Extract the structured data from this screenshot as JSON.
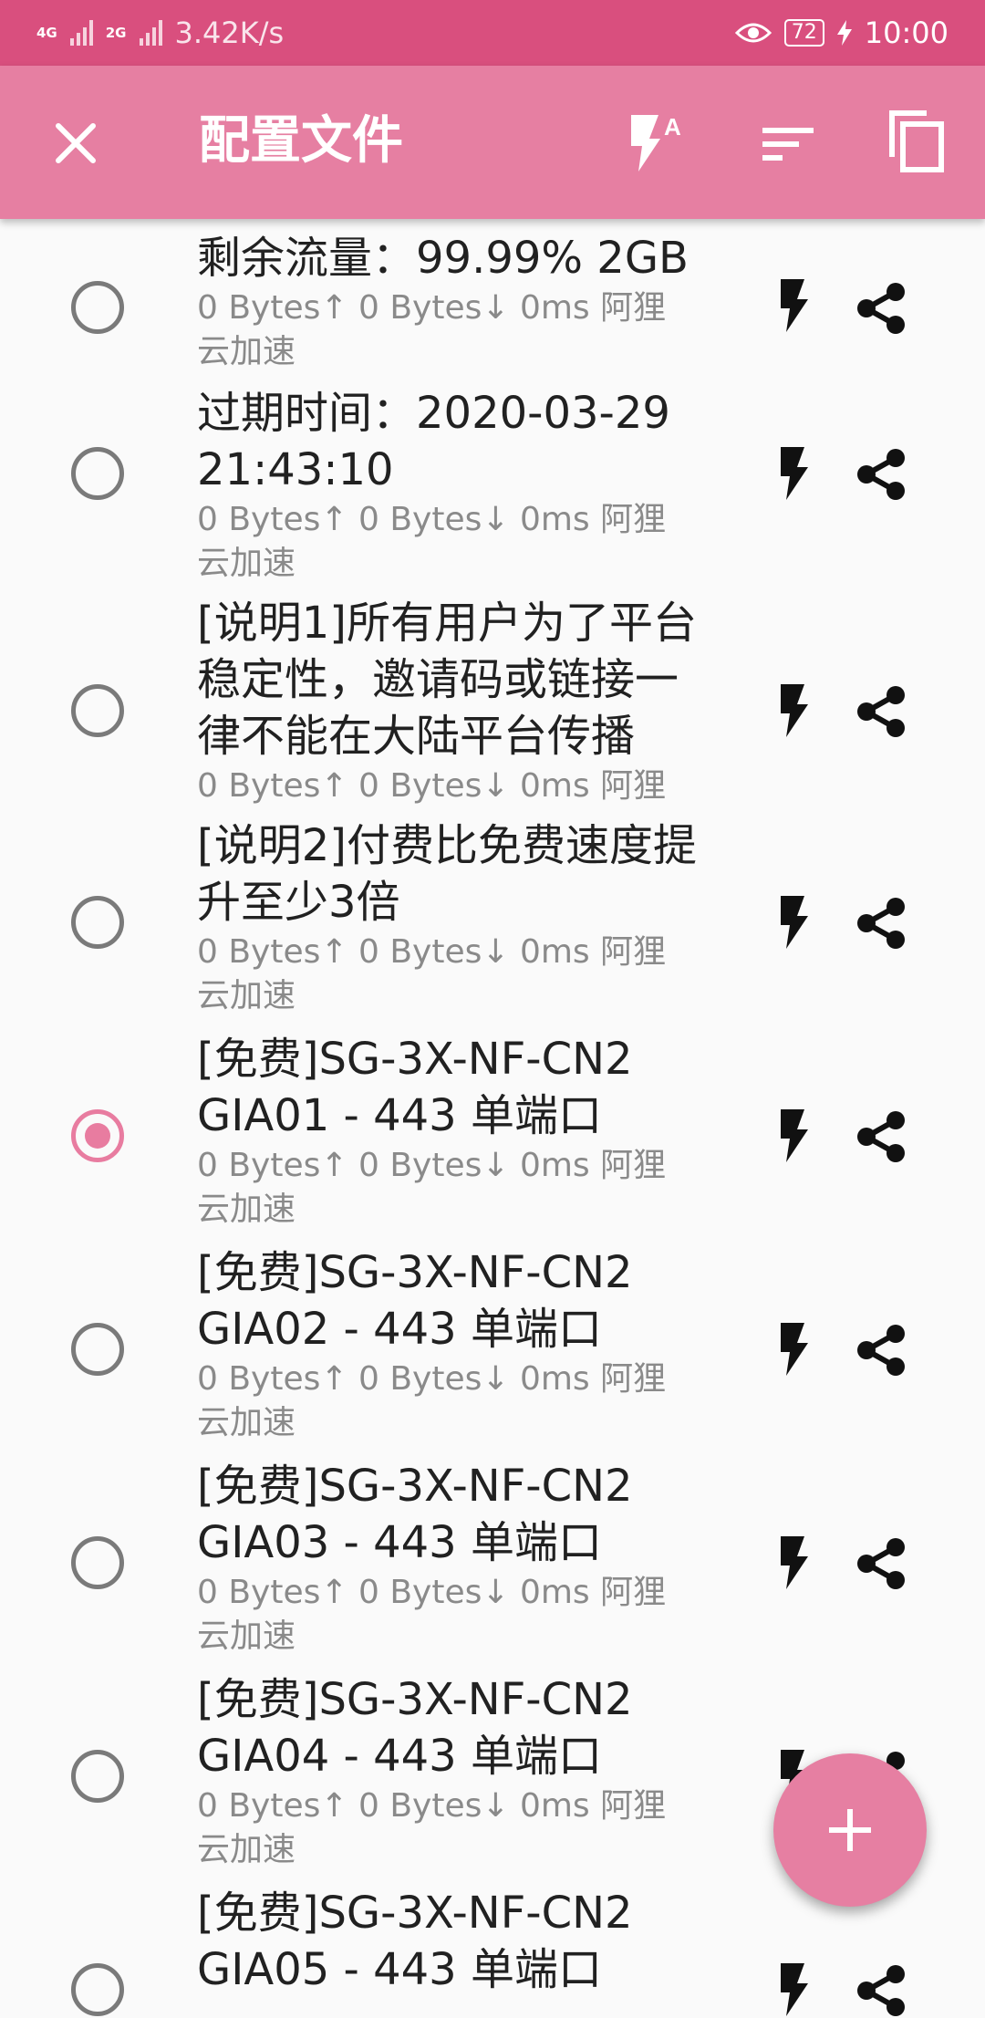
{
  "status_bar": {
    "network_1": "4G",
    "network_2": "2G",
    "speed": "3.42K/s",
    "battery": "72",
    "time": "10:00"
  },
  "app_bar": {
    "title": "配置文件",
    "icons": [
      "close-icon",
      "flash-auto-icon",
      "sort-icon",
      "copy-icon"
    ]
  },
  "accent_color": "#e67fa2",
  "status_color": "#d94f7e",
  "profiles": [
    {
      "name": "剩余流量：99.99% 2GB",
      "stats": "0 Bytes↑  0 Bytes↓  0ms  阿狸\n云加速",
      "selected": false
    },
    {
      "name": "过期时间：2020-03-29\n21:43:10",
      "stats": "0 Bytes↑  0 Bytes↓  0ms  阿狸\n云加速",
      "selected": false
    },
    {
      "name": "[说明1]所有用户为了平台\n稳定性，邀请码或链接一\n律不能在大陆平台传播",
      "stats": "0 Bytes↑  0 Bytes↓  0ms  阿狸",
      "selected": false
    },
    {
      "name": "[说明2]付费比免费速度提\n升至少3倍",
      "stats": "0 Bytes↑  0 Bytes↓  0ms  阿狸\n云加速",
      "selected": false
    },
    {
      "name": "[免费]SG-3X-NF-CN2\nGIA01 - 443 单端口",
      "stats": "0 Bytes↑  0 Bytes↓  0ms  阿狸\n云加速",
      "selected": true
    },
    {
      "name": "[免费]SG-3X-NF-CN2\nGIA02 - 443 单端口",
      "stats": "0 Bytes↑  0 Bytes↓  0ms  阿狸\n云加速",
      "selected": false
    },
    {
      "name": "[免费]SG-3X-NF-CN2\nGIA03 - 443 单端口",
      "stats": "0 Bytes↑  0 Bytes↓  0ms  阿狸\n云加速",
      "selected": false
    },
    {
      "name": "[免费]SG-3X-NF-CN2\nGIA04 - 443 单端口",
      "stats": "0 Bytes↑  0 Bytes↓  0ms  阿狸\n云加速",
      "selected": false
    },
    {
      "name": "[免费]SG-3X-NF-CN2\nGIA05 - 443 单端口",
      "stats": "",
      "selected": false
    }
  ],
  "fab": {
    "icon": "add-icon"
  }
}
